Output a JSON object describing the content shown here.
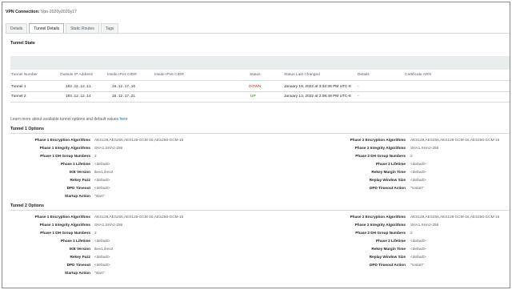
{
  "header": {
    "connection_label": "VPN Connection:",
    "connection_value": "Vpn-2020y2020y17"
  },
  "tabs": [
    {
      "label": "Details",
      "active": false
    },
    {
      "label": "Tunnel Details",
      "active": true
    },
    {
      "label": "Static Routes",
      "active": false
    },
    {
      "label": "Tags",
      "active": false
    }
  ],
  "tunnel_state": {
    "title": "Tunnel State",
    "columns": [
      "Tunnel Number",
      "Outside IP Address",
      "Inside IPv4 CIDR",
      "Inside IPv6 CIDR",
      "Status",
      "Status Last Changed",
      "Details",
      "Certificate ARN"
    ],
    "rows": [
      {
        "number": "Tunnel 1",
        "outside_ip": "103.12.12.11",
        "inside_v4": "16.12.17.16",
        "inside_v6": "",
        "status": "DOWN",
        "changed": "January 19, 2022 at 3:32:36 PM UTC-8",
        "details": "-",
        "cert": ""
      },
      {
        "number": "Tunnel 2",
        "outside_ip": "103.12.12.14",
        "inside_v4": "16.12.17.21",
        "inside_v6": "",
        "status": "UP",
        "changed": "January 13, 2022 at 2:08:49 PM UTC-8",
        "details": "-",
        "cert": ""
      }
    ],
    "status_colors": {
      "DOWN": "#d13212",
      "UP": "#1d8102"
    }
  },
  "learn_more": {
    "text": "Learn more about available tunnel options and default values",
    "link": "here"
  },
  "tunnel1_options": {
    "title": "Tunnel 1 Options",
    "left": [
      {
        "label": "Phase 1 Encryption Algorithms",
        "value": "AES128,AES256,AES128-GCM-16,AES256-GCM-16"
      },
      {
        "label": "Phase 1 Integrity Algorithms",
        "value": "SHA1,SHA2-256"
      },
      {
        "label": "Phase 1 DH Group Numbers",
        "value": "2"
      },
      {
        "label": "Phase 1 Lifetime",
        "value": "<default>"
      },
      {
        "label": "IKE Version",
        "value": "ikev1,ikev2"
      },
      {
        "label": "Rekey Fuzz",
        "value": "<default>"
      },
      {
        "label": "DPD Timeout",
        "value": "<default>"
      },
      {
        "label": "Startup Action",
        "value": "\"start\""
      }
    ],
    "right": [
      {
        "label": "Phase 2 Encryption Algorithms",
        "value": "AES128,AES256,AES128-GCM-16,AES256-GCM-16"
      },
      {
        "label": "Phase 2 Integrity Algorithms",
        "value": "SHA1,SHA2-256"
      },
      {
        "label": "Phase 2 DH Group Numbers",
        "value": "2"
      },
      {
        "label": "Phase 2 Lifetime",
        "value": "<default>"
      },
      {
        "label": "Rekey Margin Time",
        "value": "<default>"
      },
      {
        "label": "Replay Window Size",
        "value": "<default>"
      },
      {
        "label": "DPD Timeout Action",
        "value": "\"restart\""
      }
    ]
  },
  "tunnel2_options": {
    "title": "Tunnel 2 Options",
    "left": [
      {
        "label": "Phase 1 Encryption Algorithms",
        "value": "AES128,AES256,AES128-GCM-16,AES256-GCM-16"
      },
      {
        "label": "Phase 1 Integrity Algorithms",
        "value": "SHA1,SHA2-256"
      },
      {
        "label": "Phase 1 DH Group Numbers",
        "value": "2"
      },
      {
        "label": "Phase 1 Lifetime",
        "value": "<default>"
      },
      {
        "label": "IKE Version",
        "value": "ikev1,ikev2"
      },
      {
        "label": "Rekey Fuzz",
        "value": "<default>"
      },
      {
        "label": "DPD Timeout",
        "value": "<default>"
      },
      {
        "label": "Startup Action",
        "value": "\"start\""
      }
    ],
    "right": [
      {
        "label": "Phase 2 Encryption Algorithms",
        "value": "AES128,AES256,AES128-GCM-16,AES256-GCM-16"
      },
      {
        "label": "Phase 2 Integrity Algorithms",
        "value": "SHA1,SHA2-256"
      },
      {
        "label": "Phase 2 DH Group Numbers",
        "value": "2"
      },
      {
        "label": "Phase 2 Lifetime",
        "value": "<default>"
      },
      {
        "label": "Rekey Margin Time",
        "value": "<default>"
      },
      {
        "label": "Replay Window Size",
        "value": "<default>"
      },
      {
        "label": "DPD Timeout Action",
        "value": "\"restart\""
      }
    ]
  }
}
